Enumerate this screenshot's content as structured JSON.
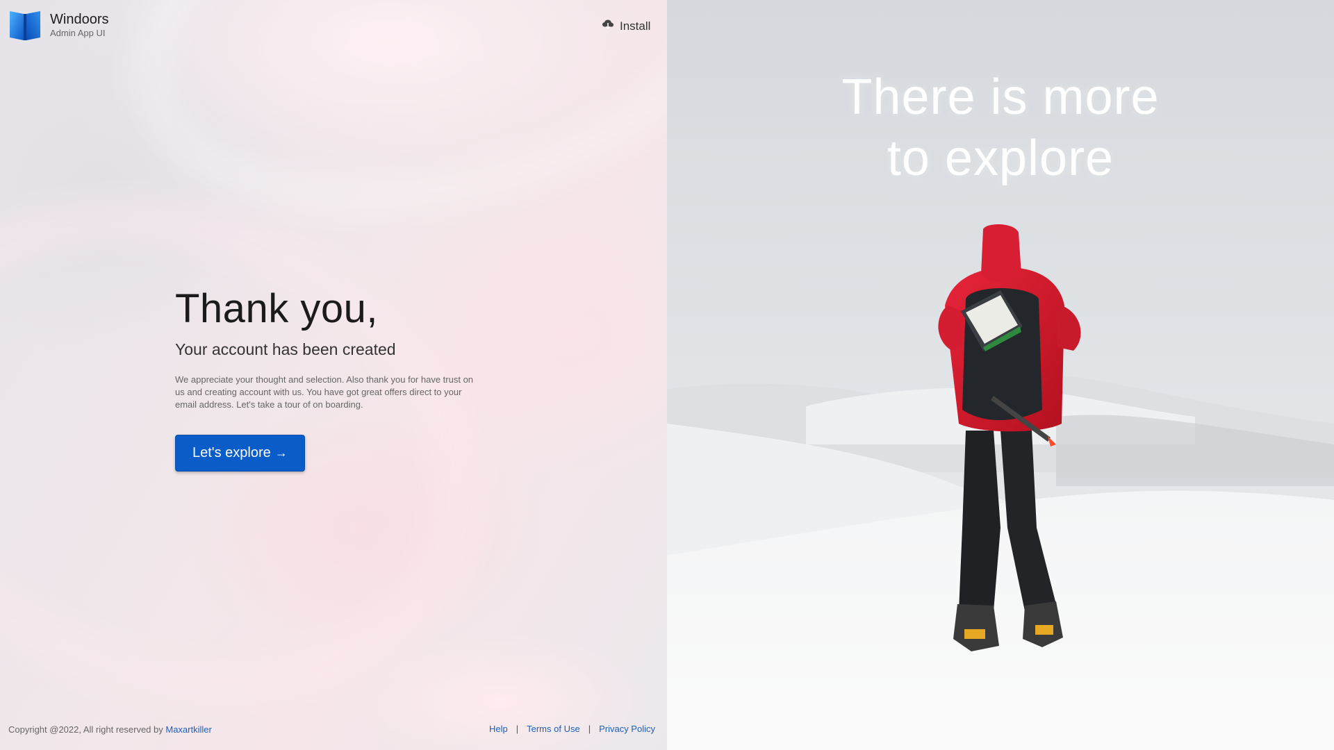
{
  "brand": {
    "name": "Windoors",
    "subtitle": "Admin App UI",
    "logo_icon": "windoors-logo-icon"
  },
  "header": {
    "install_label": "Install",
    "install_icon": "cloud-download-icon"
  },
  "main": {
    "title": "Thank you,",
    "subtitle": "Your account has been created",
    "description": "We appreciate your thought and selection. Also thank you for have trust on us and creating account with us. You have got great offers direct to your email address. Let's take a tour of on boarding.",
    "cta_label": "Let's explore",
    "cta_icon": "arrow-right-icon"
  },
  "footer": {
    "copyright": "Copyright @2022, All right reserved by ",
    "author": "Maxartkiller",
    "links": [
      "Help",
      "Terms of Use",
      "Privacy Policy"
    ]
  },
  "hero": {
    "line1": "There is more",
    "line2": "to explore"
  },
  "colors": {
    "accent": "#0a5cc8",
    "link": "#1e5fb9"
  }
}
